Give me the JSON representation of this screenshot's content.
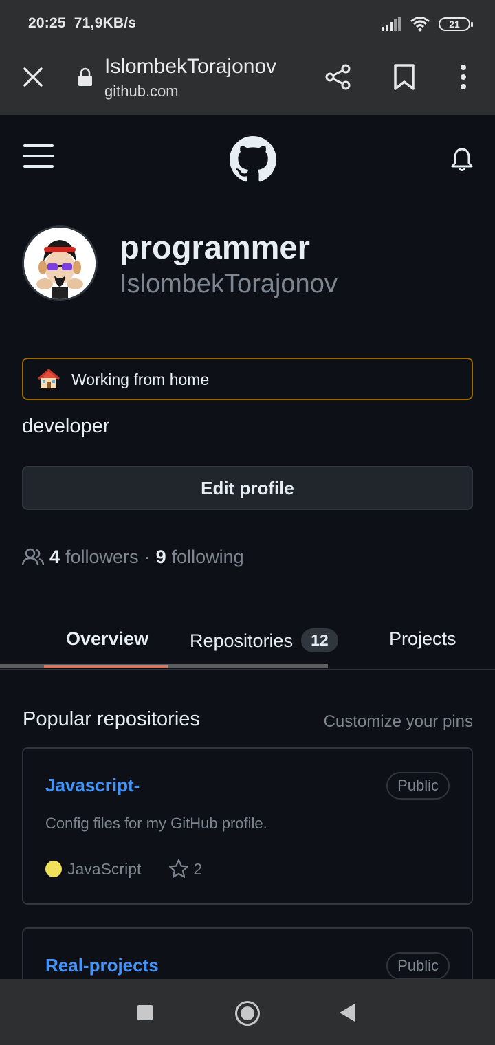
{
  "status_bar": {
    "time": "20:25",
    "speed": "71,9KB/s",
    "battery": "21",
    "icons": [
      "signal-icon",
      "wifi-icon",
      "battery-icon"
    ]
  },
  "browser": {
    "title": "IslombekTorajonov",
    "domain": "github.com",
    "icons": [
      "close-icon",
      "lock-icon",
      "share-icon",
      "bookmark-icon",
      "more-vert-icon"
    ]
  },
  "github_header": {
    "icons": [
      "hamburger-menu-icon",
      "github-logo-icon",
      "bell-icon"
    ]
  },
  "profile": {
    "display_name": "programmer",
    "username": "IslombekTorajonov",
    "status_emoji": "house-emoji-icon",
    "status_text": "Working from home",
    "bio": "developer",
    "edit_button": "Edit profile",
    "followers_count": "4",
    "followers_label": "followers",
    "separator": "·",
    "following_count": "9",
    "following_label": "following"
  },
  "tabs": {
    "overview": "Overview",
    "repositories": "Repositories",
    "repositories_count": "12",
    "projects": "Projects"
  },
  "popular": {
    "title": "Popular repositories",
    "customize": "Customize your pins",
    "repos": [
      {
        "name": "Javascript-",
        "visibility": "Public",
        "description": "Config files for my GitHub profile.",
        "language": "JavaScript",
        "language_color": "#f1e05a",
        "stars": "2"
      },
      {
        "name": "Real-projects",
        "visibility": "Public"
      }
    ]
  },
  "colors": {
    "background": "#0d1117",
    "accent_link": "#4493f8",
    "status_border": "#9e6a03",
    "tab_underline": "#f78166"
  },
  "navigation_bar": {
    "icons": [
      "recents-square-icon",
      "home-circle-icon",
      "back-triangle-icon"
    ]
  }
}
